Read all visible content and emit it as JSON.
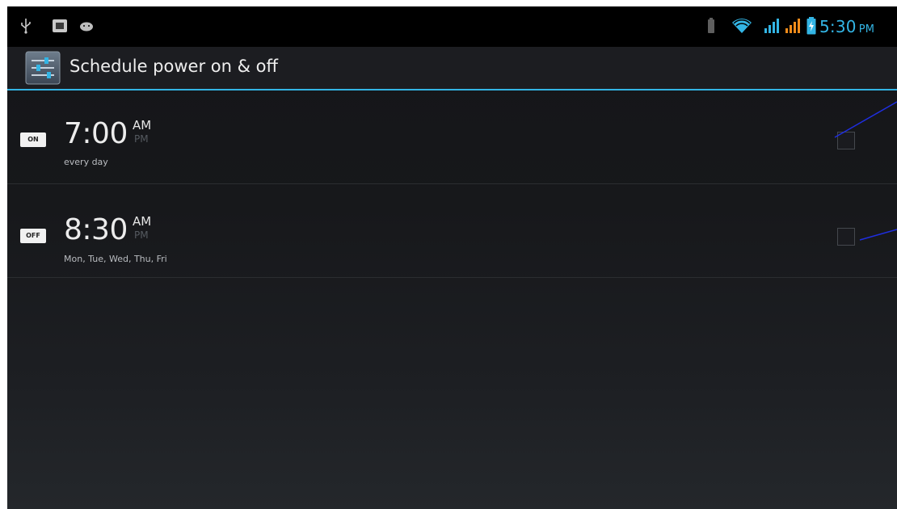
{
  "status_bar": {
    "time": "5:30",
    "ampm": "PM",
    "icons": {
      "left": [
        "usb-icon",
        "image-notification-icon",
        "android-icon"
      ],
      "right": [
        "battery-small-icon",
        "wifi-icon",
        "signal-icon",
        "signal-icon",
        "battery-icon"
      ]
    }
  },
  "action_bar": {
    "title": "Schedule power on & off",
    "app_icon": "settings-sliders-icon"
  },
  "colors": {
    "accent": "#33b5e5",
    "signal_orange": "#f28c1a",
    "text": "#ececec",
    "background": "#17181b"
  },
  "schedules": [
    {
      "mode": "ON",
      "time": "7:00",
      "am": "AM",
      "pm": "PM",
      "repeat": "every day",
      "checked": false
    },
    {
      "mode": "OFF",
      "time": "8:30",
      "am": "AM",
      "pm": "PM",
      "repeat": "Mon, Tue, Wed, Thu, Fri",
      "checked": false
    }
  ]
}
